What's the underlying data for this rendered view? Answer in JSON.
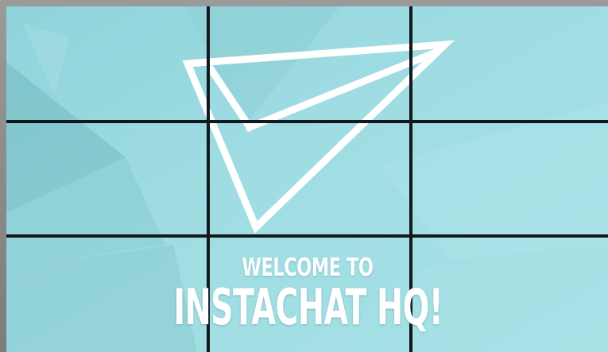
{
  "wall": {
    "rows": 3,
    "columns": 3,
    "background_color": "#9ddfe4",
    "logo_color": "#ffffff",
    "bezel_color": "#14181c",
    "logo_icon": "paper-plane-icon"
  },
  "message": {
    "line1": "WELCOME TO",
    "line2": "INSTACHAT HQ!"
  }
}
